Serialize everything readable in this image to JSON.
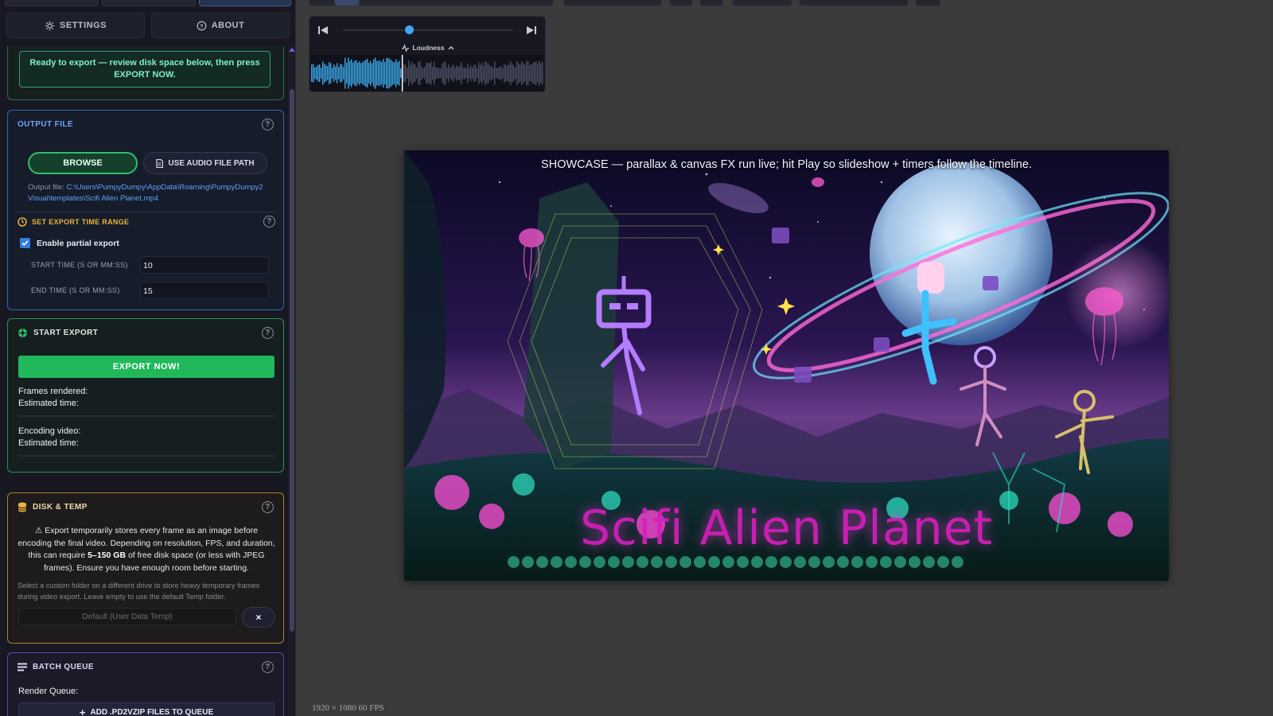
{
  "nav": {
    "settings": "SETTINGS",
    "about": "ABOUT"
  },
  "ready": {
    "message": "Ready to export — review disk space below, then press EXPORT NOW."
  },
  "output_file": {
    "title": "OUTPUT FILE",
    "browse": "BROWSE",
    "use_audio_path": "USE AUDIO FILE PATH",
    "output_label": "Output file:",
    "output_path": "C:\\Users\\PumpyDumpy\\AppData\\Roaming\\PumpyDumpy2Visual\\templates\\Scifi Alien Planet.mp4",
    "time_range_title": "SET EXPORT TIME RANGE",
    "partial_label": "Enable partial export",
    "partial_checked": true,
    "start_label": "START TIME (S OR MM:SS)",
    "start_value": "10",
    "end_label": "END TIME (S OR MM:SS)",
    "end_value": "15"
  },
  "start_export": {
    "title": "START EXPORT",
    "button": "EXPORT NOW!",
    "frames_rendered": "Frames rendered:",
    "estimated_time_1": "Estimated time:",
    "encoding_video": "Encoding video:",
    "estimated_time_2": "Estimated time:"
  },
  "disk_temp": {
    "title": "DISK & TEMP",
    "warning_pre": "⚠ Export temporarily stores every frame as an image before encoding the final video. Depending on resolution, FPS, and duration, this can require ",
    "warning_bold": "5–150 GB",
    "warning_post": " of free disk space (or less with JPEG frames). Ensure you have enough room before starting.",
    "hint": "Select a custom folder on a different drive to store heavy temporary frames during video export. Leave empty to use the default Temp folder.",
    "placeholder": "Default (User Data Temp)",
    "clear": "×"
  },
  "batch": {
    "title": "BATCH QUEUE",
    "render_queue": "Render Queue:",
    "add_button": "ADD .PD2VZIP FILES TO QUEUE"
  },
  "transport": {
    "label": "Loudness",
    "position": 0.39
  },
  "preview": {
    "banner": "SHOWCASE — parallax & canvas FX run live; hit Play so slideshow + timers follow the timeline.",
    "title": "Scifi Alien Planet",
    "meta": "1920 × 1080   60 FPS"
  },
  "colors": {
    "accent_blue": "#3466b6",
    "accent_green": "#21b75b",
    "warning": "#b0802e",
    "title_magenta": "#d61fbd"
  }
}
